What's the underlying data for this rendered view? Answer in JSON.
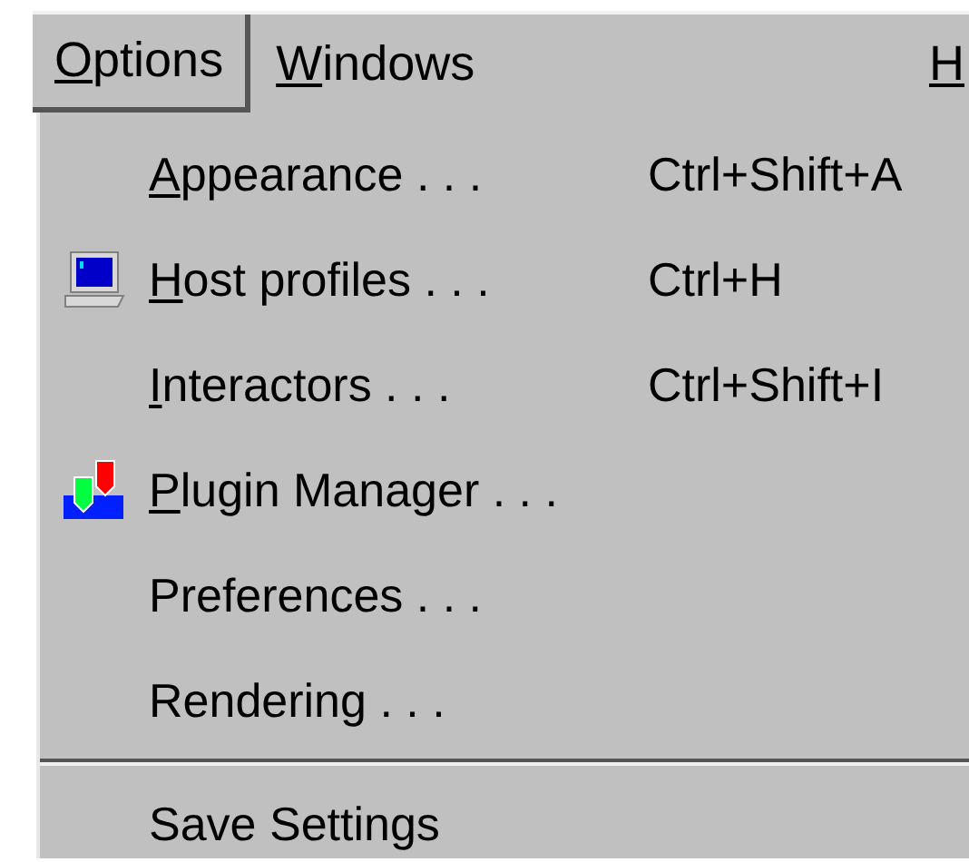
{
  "menubar": [
    {
      "label": "Options",
      "mnemonic": true,
      "selected": true
    },
    {
      "label": "Windows",
      "mnemonic": true,
      "selected": false
    },
    {
      "label": "H",
      "mnemonic": true,
      "selected": false
    }
  ],
  "menu": {
    "items": [
      {
        "kind": "item",
        "label": "Appearance . . .",
        "mnemonic": true,
        "shortcut": "Ctrl+Shift+A"
      },
      {
        "kind": "item",
        "label": "Host profiles . . .",
        "mnemonic": true,
        "shortcut": "Ctrl+H"
      },
      {
        "kind": "item",
        "label": "Interactors . . .",
        "mnemonic": true,
        "shortcut": "Ctrl+Shift+I"
      },
      {
        "kind": "item",
        "label": "Plugin Manager . . .",
        "mnemonic": true
      },
      {
        "kind": "item",
        "label": "Preferences . . .",
        "mnemonic": false
      },
      {
        "kind": "item",
        "label": "Rendering . . .",
        "mnemonic": false
      },
      {
        "kind": "separator"
      },
      {
        "kind": "item",
        "label": "Save Settings",
        "mnemonic": false
      }
    ]
  }
}
